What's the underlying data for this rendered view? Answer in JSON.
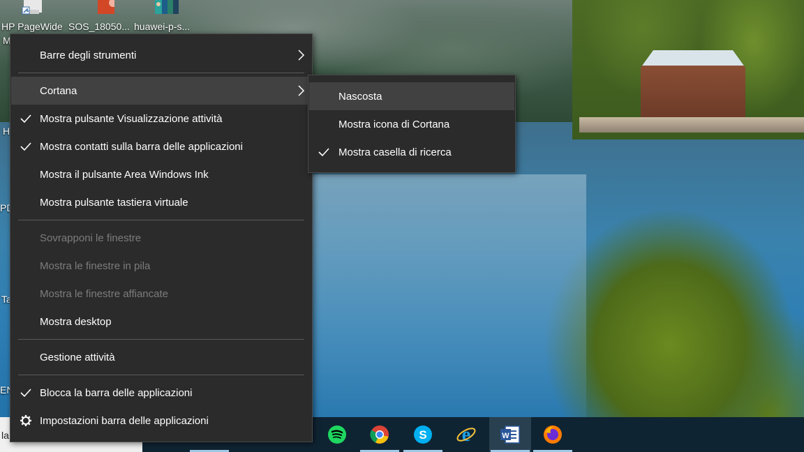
{
  "desktop": {
    "icons": [
      {
        "label": "HP PageWide",
        "icon": "printer-icon"
      },
      {
        "label": "SOS_18050...",
        "icon": "powerpoint-file-icon"
      },
      {
        "label": "huawei-p-s...",
        "icon": "image-file-icon"
      }
    ],
    "left_clipped_labels": [
      "M",
      "H",
      "PD",
      "Ta",
      "EN",
      "la"
    ]
  },
  "context_menu": {
    "items": [
      {
        "label": "Barre degli strumenti",
        "checked": false,
        "submenu": true
      },
      {
        "label": "Cortana",
        "checked": false,
        "submenu": true,
        "highlighted": true
      },
      {
        "label": "Mostra pulsante Visualizzazione attività",
        "checked": true
      },
      {
        "label": "Mostra contatti sulla barra delle applicazioni",
        "checked": true
      },
      {
        "label": "Mostra il pulsante Area Windows Ink",
        "checked": false
      },
      {
        "label": "Mostra pulsante tastiera virtuale",
        "checked": false
      },
      {
        "label": "Sovrapponi le finestre",
        "disabled": true
      },
      {
        "label": "Mostra le finestre in pila",
        "disabled": true
      },
      {
        "label": "Mostra le finestre affiancate",
        "disabled": true
      },
      {
        "label": "Mostra desktop"
      },
      {
        "label": "Gestione attività"
      },
      {
        "label": "Blocca la barra delle applicazioni",
        "checked": true
      },
      {
        "label": "Impostazioni barra delle applicazioni",
        "icon": "gear-icon"
      }
    ]
  },
  "cortana_submenu": {
    "items": [
      {
        "label": "Nascosta",
        "highlighted": true
      },
      {
        "label": "Mostra icona di Cortana"
      },
      {
        "label": "Mostra casella di ricerca",
        "checked": true
      }
    ]
  },
  "taskbar": {
    "apps": [
      {
        "name": "spotify-icon"
      },
      {
        "name": "chrome-icon"
      },
      {
        "name": "skype-icon"
      },
      {
        "name": "internet-explorer-icon"
      },
      {
        "name": "word-icon",
        "active": true
      },
      {
        "name": "firefox-icon"
      }
    ]
  },
  "colors": {
    "menu_bg": "#2b2b2b",
    "menu_highlight": "#414141",
    "disabled_text": "#7c7c7c",
    "taskbar_bg": "#0f2433"
  }
}
